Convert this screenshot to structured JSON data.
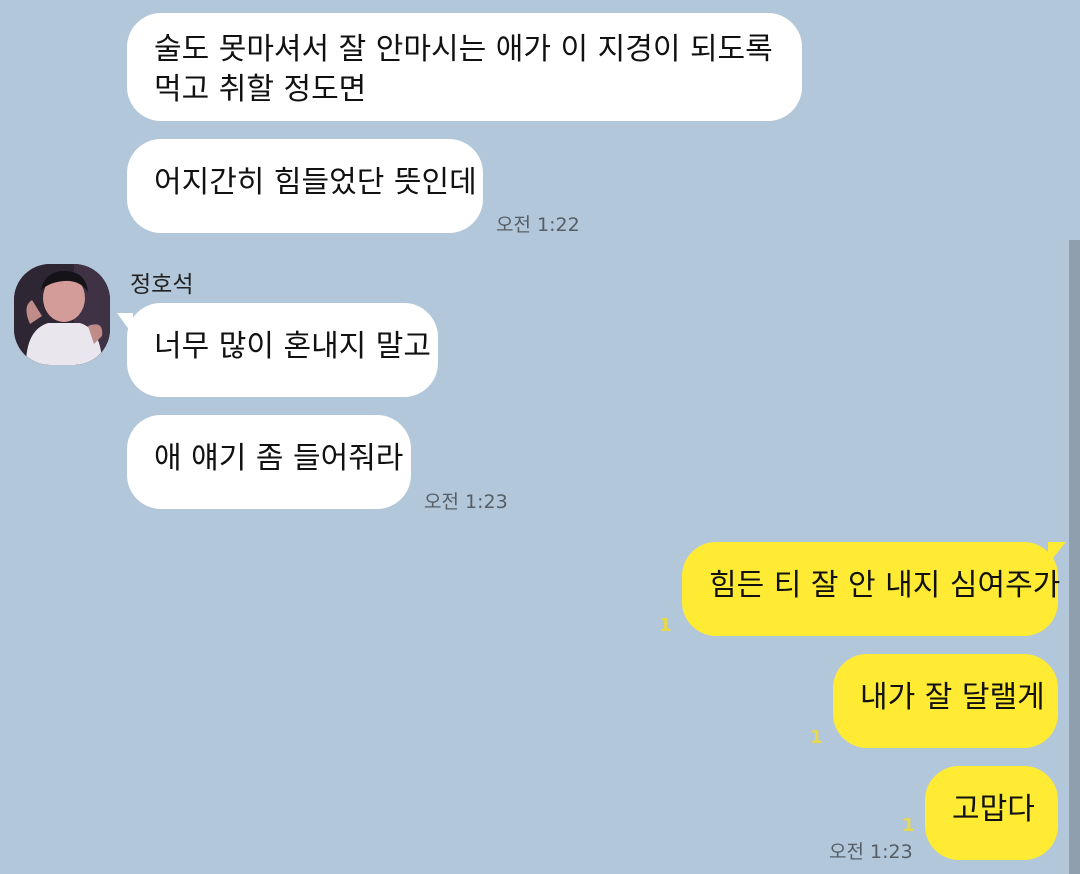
{
  "chat": {
    "sender_name": "정호석",
    "messages": [
      {
        "text": "술도 못마셔서 잘 안마시는 애가 이 지경이 되도록\n먹고 취할 정도면"
      },
      {
        "text": "어지간히 힘들었단 뜻인데",
        "time": "오전 1:22"
      },
      {
        "text": "너무 많이 혼내지 말고"
      },
      {
        "text": "애 얘기 좀 들어줘라",
        "time": "오전 1:23"
      },
      {
        "text": "힘든 티 잘 안 내지 심여주가",
        "unread": "1"
      },
      {
        "text": "내가 잘 달랠게",
        "unread": "1"
      },
      {
        "text": "고맙다",
        "unread": "1",
        "time": "오전 1:23"
      }
    ]
  },
  "colors": {
    "background": "#b2c7da",
    "incoming_bubble": "#ffffff",
    "outgoing_bubble": "#ffeb33",
    "unread_count": "#e8d84a"
  }
}
